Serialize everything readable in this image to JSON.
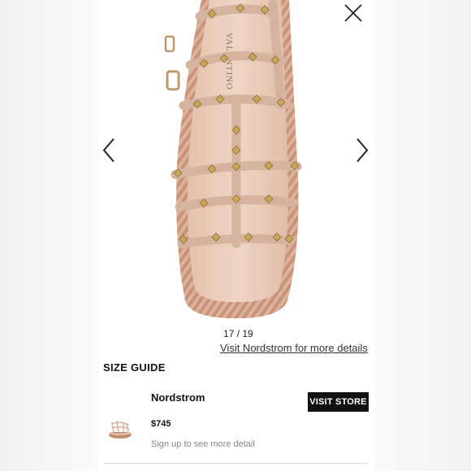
{
  "gallery": {
    "counter": "17 / 19",
    "visit_link": "Visit Nordstrom for more details",
    "product_image": "valentino-rockstud-sandal-top-view",
    "brand_mark": "VALENTINO"
  },
  "size_guide": "SIZE GUIDE",
  "store": {
    "name": "Nordstrom",
    "button": "VISIT STORE",
    "price": "$745",
    "signup": "Sign up to see more detail"
  },
  "icons": {
    "close": "close-icon",
    "prev": "chevron-left-icon",
    "next": "chevron-right-icon"
  },
  "colors": {
    "button_bg": "#111111",
    "strap": "#d9b8a4",
    "stud": "#c8a55a",
    "rope": "#c48e73"
  }
}
